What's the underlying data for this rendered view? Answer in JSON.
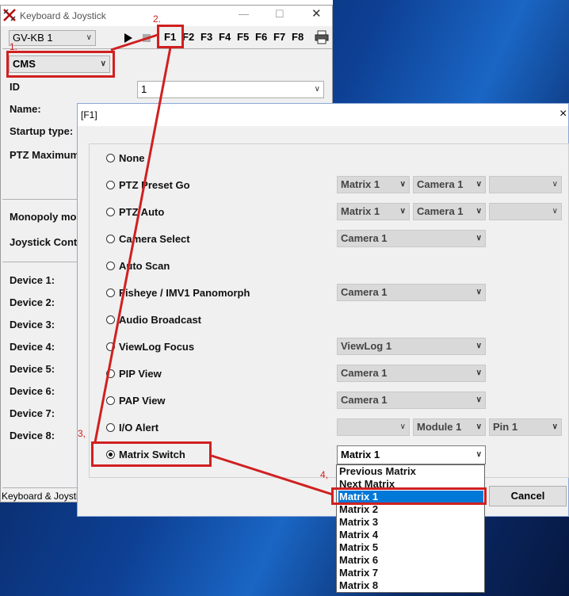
{
  "main_window": {
    "title": "Keyboard & Joystick",
    "device_select": "GV-KB 1",
    "fkeys": [
      "F1",
      "F2",
      "F3",
      "F4",
      "F5",
      "F6",
      "F7",
      "F8"
    ],
    "mode_select": "CMS",
    "id_label": "ID",
    "id_value": "1",
    "name_label": "Name:",
    "startup_label": "Startup type:",
    "ptz_label": "PTZ Maximum",
    "monopoly_label": "Monopoly mo",
    "joystick_label": "Joystick Cont",
    "devices": [
      "Device 1:",
      "Device 2:",
      "Device 3:",
      "Device 4:",
      "Device 5:",
      "Device 6:",
      "Device 7:",
      "Device 8:"
    ],
    "status_text": "Keyboard & Joystic"
  },
  "dialog": {
    "title": "[F1]",
    "close": "×",
    "options": [
      {
        "label": "None",
        "selected": false
      },
      {
        "label": "PTZ Preset Go",
        "selected": false
      },
      {
        "label": "PTZ Auto",
        "selected": false
      },
      {
        "label": "Camera Select",
        "selected": false
      },
      {
        "label": "Auto Scan",
        "selected": false
      },
      {
        "label": "Fisheye / IMV1 Panomorph",
        "selected": false
      },
      {
        "label": "Audio Broadcast",
        "selected": false
      },
      {
        "label": "ViewLog Focus",
        "selected": false
      },
      {
        "label": "PIP View",
        "selected": false
      },
      {
        "label": "PAP View",
        "selected": false
      },
      {
        "label": "I/O Alert",
        "selected": false
      },
      {
        "label": "Matrix Switch",
        "selected": true
      }
    ],
    "combos": {
      "preset_matrix": "Matrix 1",
      "preset_camera": "Camera 1",
      "auto_matrix": "Matrix 1",
      "auto_camera": "Camera 1",
      "camera_select": "Camera 1",
      "fisheye_camera": "Camera 1",
      "viewlog": "ViewLog 1",
      "pip_camera": "Camera 1",
      "pap_camera": "Camera 1",
      "io_module": "Module 1",
      "io_pin": "Pin 1",
      "matrix_switch": "Matrix 1"
    },
    "cancel_label": "Cancel",
    "matrix_dropdown_items": [
      "Previous Matrix",
      "Next Matrix",
      "Matrix 1",
      "Matrix 2",
      "Matrix 3",
      "Matrix 4",
      "Matrix 5",
      "Matrix 6",
      "Matrix 7",
      "Matrix 8"
    ],
    "matrix_dropdown_selected": "Matrix 1"
  },
  "annotations": {
    "step1": "1.",
    "step2": "2.",
    "step3": "3,",
    "step4": "4,",
    "color": "#d02020"
  }
}
